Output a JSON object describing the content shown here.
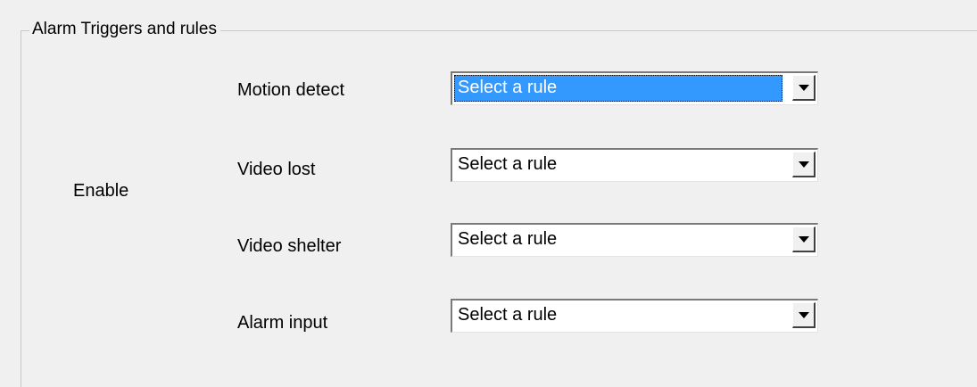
{
  "group": {
    "title": "Alarm Triggers and rules"
  },
  "enable_label": "Enable",
  "rows": [
    {
      "label": "Motion detect",
      "value": "Select a rule",
      "focused": true
    },
    {
      "label": "Video lost",
      "value": "Select a rule",
      "focused": false
    },
    {
      "label": "Video shelter",
      "value": "Select a rule",
      "focused": false
    },
    {
      "label": "Alarm input",
      "value": "Select a rule",
      "focused": false
    }
  ],
  "colors": {
    "selection_highlight": "#3399ff",
    "background": "#f0f0f0"
  },
  "icons": {
    "dropdown": "chevron-down-icon"
  }
}
